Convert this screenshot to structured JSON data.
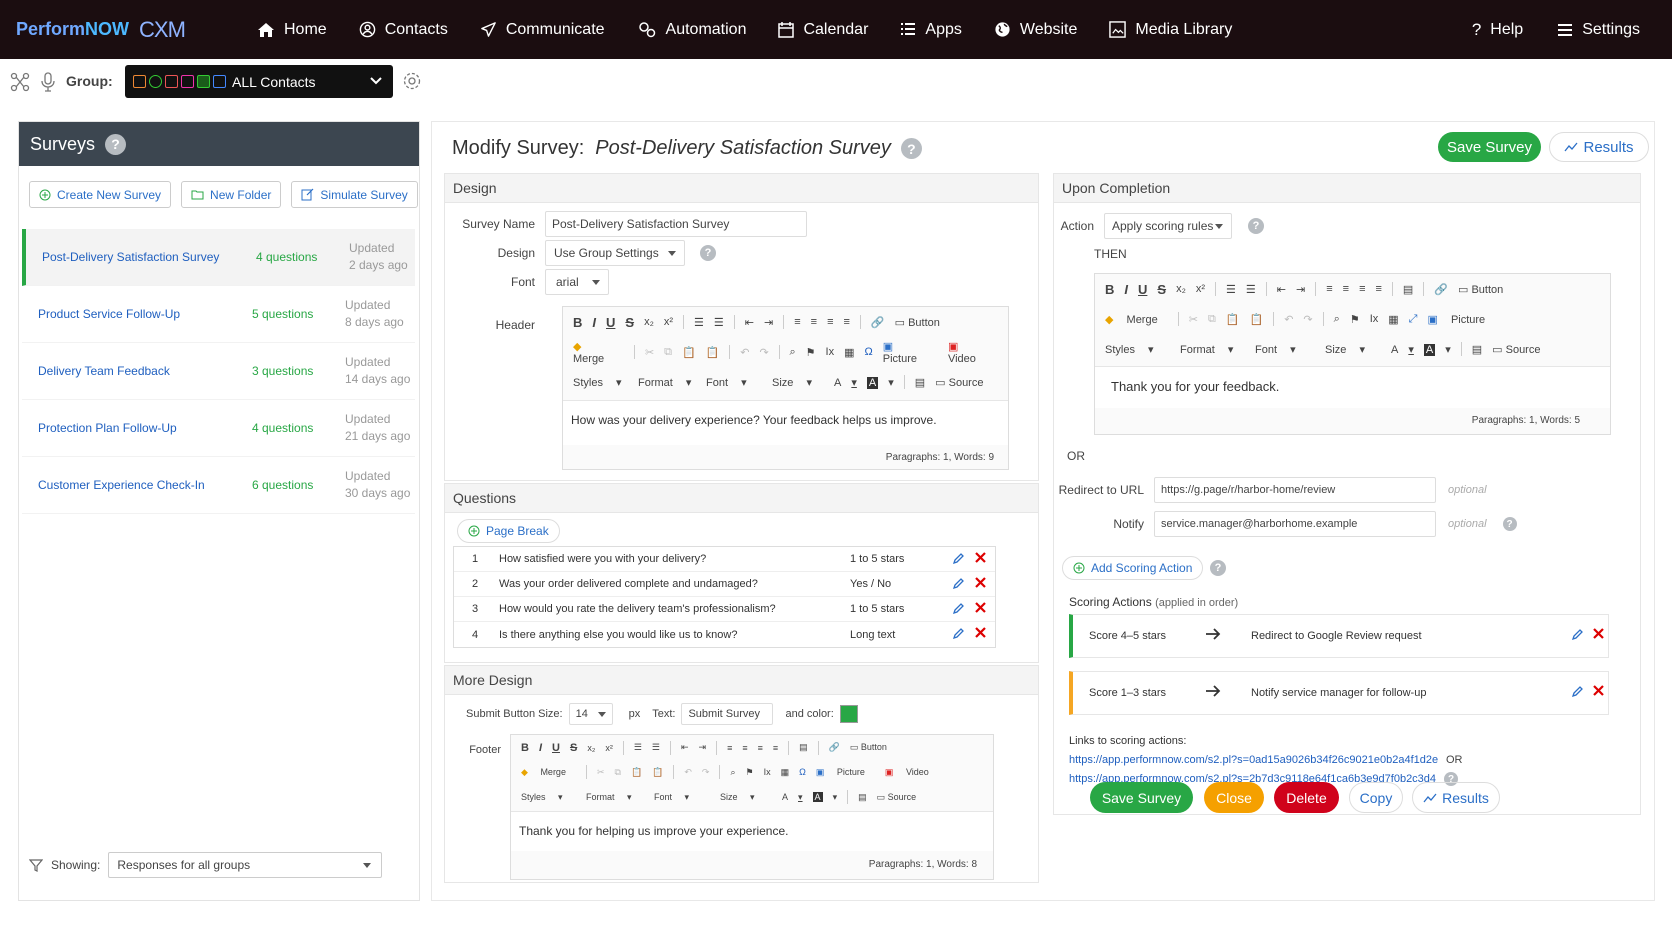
{
  "brand": {
    "perform": "Perform",
    "now": "NOW",
    "cxm": "CXM"
  },
  "nav": {
    "home": "Home",
    "contacts": "Contacts",
    "communicate": "Communicate",
    "automation": "Automation",
    "calendar": "Calendar",
    "apps": "Apps",
    "website": "Website",
    "media": "Media Library",
    "help": "Help",
    "settings": "Settings"
  },
  "group": {
    "label": "Group:",
    "value": "ALL Contacts"
  },
  "surveys": {
    "title": "Surveys",
    "help": "?",
    "create": "Create New Survey",
    "new_folder": "New Folder",
    "simulate": "Simulate Survey",
    "items": [
      {
        "name": "Post-Delivery Satisfaction Survey",
        "questions": "4 questions",
        "updated": "Updated",
        "ago": "2 days ago"
      },
      {
        "name": "Product Service Follow-Up",
        "questions": "5 questions",
        "updated": "Updated",
        "ago": "8 days ago"
      },
      {
        "name": "Delivery Team Feedback",
        "questions": "3 questions",
        "updated": "Updated",
        "ago": "14 days ago"
      },
      {
        "name": "Protection Plan Follow-Up",
        "questions": "4 questions",
        "updated": "Updated",
        "ago": "21 days ago"
      },
      {
        "name": "Customer Experience Check-In",
        "questions": "6 questions",
        "updated": "Updated",
        "ago": "30 days ago"
      }
    ],
    "showing_label": "Showing:",
    "showing_value": "Responses for all groups"
  },
  "main": {
    "title": "Modify Survey:",
    "survey_name": "Post-Delivery Satisfaction Survey",
    "help": "?",
    "save": "Save Survey",
    "results": "Results"
  },
  "design": {
    "heading": "Design",
    "survey_name_label": "Survey Name",
    "survey_name_value": "Post-Delivery Satisfaction Survey",
    "design_label": "Design",
    "design_value": "Use Group Settings",
    "font_label": "Font",
    "font_value": "arial",
    "header_label": "Header",
    "header_text": "How was your delivery experience? Your feedback helps us improve.",
    "header_stats": "Paragraphs: 1, Words: 9"
  },
  "toolbar": {
    "button": "Button",
    "merge": "Merge",
    "picture": "Picture",
    "video": "Video",
    "styles": "Styles",
    "format": "Format",
    "font": "Font",
    "size": "Size",
    "source": "Source",
    "bold": "B",
    "italic": "I",
    "underline": "U",
    "strike": "S",
    "sub": "x₂",
    "sup": "x²",
    "omega": "Ω",
    "clear": "Ix",
    "color": "A"
  },
  "questions": {
    "heading": "Questions",
    "page_break": "Page Break",
    "rows": [
      {
        "n": "1",
        "text": "How satisfied were you with your delivery?",
        "type": "1 to 5 stars"
      },
      {
        "n": "2",
        "text": "Was your order delivered complete and undamaged?",
        "type": "Yes / No"
      },
      {
        "n": "3",
        "text": "How would you rate the delivery team's professionalism?",
        "type": "1 to 5 stars"
      },
      {
        "n": "4",
        "text": "Is there anything else you would like us to know?",
        "type": "Long text"
      }
    ]
  },
  "more_design": {
    "heading": "More Design",
    "size_label": "Submit Button Size:",
    "size_value": "14",
    "px": "px",
    "text_label": "Text:",
    "text_value": "Submit Survey",
    "color_label": "and color:",
    "button_color": "#28a745",
    "footer_label": "Footer",
    "footer_text": "Thank you for helping us improve your experience.",
    "footer_stats": "Paragraphs: 1, Words: 8"
  },
  "completion": {
    "heading": "Upon Completion",
    "action_label": "Action",
    "action_value": "Apply scoring rules",
    "then": "THEN",
    "message": "Thank you for your feedback.",
    "message_stats": "Paragraphs: 1, Words: 5",
    "or": "OR",
    "redirect_label": "Redirect to URL",
    "redirect_value": "https://g.page/r/harbor-home/review",
    "optional": "optional",
    "notify_label": "Notify",
    "notify_value": "service.manager@harborhome.example",
    "add_scoring": "Add Scoring Action",
    "scoring_title": "Scoring Actions",
    "scoring_sub": "(applied in order)",
    "actions": [
      {
        "score": "Score 4–5 stars",
        "desc": "Redirect to Google Review request",
        "color": "#28a745"
      },
      {
        "score": "Score 1–3 stars",
        "desc": "Notify service manager for follow-up",
        "color": "#f5a623"
      }
    ],
    "links_label": "Links to scoring actions:",
    "link1": "https://app.performnow.com/s2.pl?s=0ad15a9026b34f26c9021e0b2a4f1d2e",
    "link_or": "OR",
    "link2": "https://app.performnow.com/s2.pl?s=2b7d3c9118e64f1ca6b3e9d7f0b2c3d4"
  },
  "actions": {
    "save": "Save Survey",
    "close": "Close",
    "delete": "Delete",
    "copy": "Copy",
    "results": "Results"
  }
}
